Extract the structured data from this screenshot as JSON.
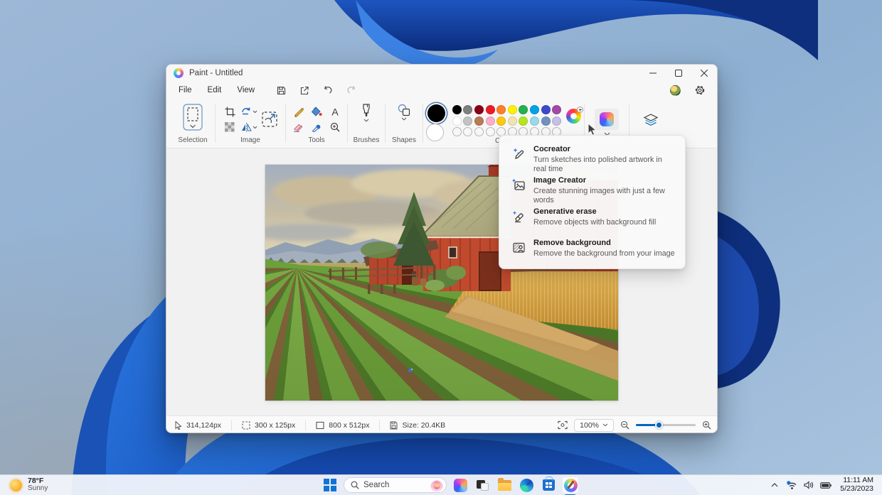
{
  "icons": {
    "text_glyph": "A"
  },
  "desktop": {
    "weather": {
      "temperature": "78°F",
      "condition": "Sunny"
    }
  },
  "taskbar": {
    "search_placeholder": "Search",
    "tray": {
      "time": "11:11 AM",
      "date": "5/23/2023"
    }
  },
  "paint": {
    "title": "Paint - Untitled",
    "menu": {
      "file": "File",
      "edit": "Edit",
      "view": "View"
    },
    "ribbon": {
      "selection": "Selection",
      "image": "Image",
      "tools": "Tools",
      "brushes": "Brushes",
      "shapes": "Shapes",
      "color": "Color"
    },
    "palette": {
      "foreground": "#000000",
      "background": "#ffffff",
      "row1": [
        "#000000",
        "#7f7f7f",
        "#880015",
        "#ed1c24",
        "#ff7f27",
        "#fff200",
        "#22b14c",
        "#00a2e8",
        "#3f48cc",
        "#a349a4"
      ],
      "row2": [
        "#ffffff",
        "#c3c3c3",
        "#b97a57",
        "#ffaec9",
        "#ffc90e",
        "#efe4b0",
        "#b5e61d",
        "#99d9ea",
        "#7092be",
        "#c8bfe7"
      ],
      "empty_slots": 10
    },
    "copilot_flyout": {
      "items": [
        {
          "title": "Cocreator",
          "description": "Turn sketches into polished artwork in real time"
        },
        {
          "title": "Image Creator",
          "description": "Create stunning images with just a few words"
        },
        {
          "title": "Generative erase",
          "description": "Remove objects with background fill"
        },
        {
          "title": "Remove background",
          "description": "Remove the background from your image"
        }
      ]
    },
    "statusbar": {
      "cursor_position": "314,124px",
      "selection_size": "300 x 125px",
      "canvas_size": "800 x 512px",
      "file_size": "Size: 20.4KB",
      "zoom_level": "100%"
    },
    "canvas_image_alt": "Oil painting of a farm field with a red barn, golden wheat and rows of green crops"
  }
}
